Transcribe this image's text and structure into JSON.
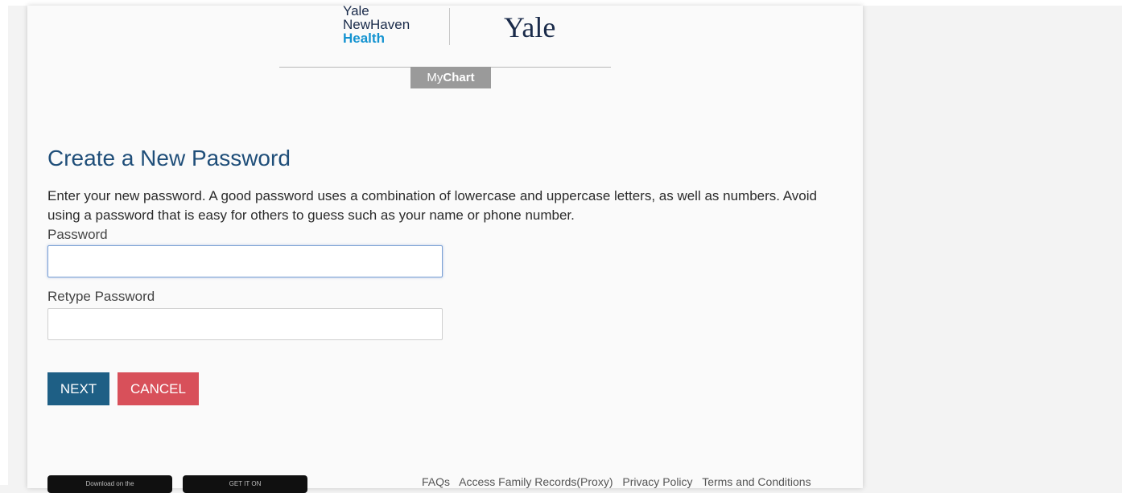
{
  "header": {
    "logo_ynh_line1": "Yale",
    "logo_ynh_line2": "NewHaven",
    "logo_ynh_line3": "Health",
    "logo_yale": "Yale",
    "mychart_my": "My",
    "mychart_chart": "Chart"
  },
  "form": {
    "title": "Create a New Password",
    "instructions": "Enter your new password. A good password uses a combination of lowercase and uppercase letters, as well as numbers. Avoid using a password that is easy for others to guess such as your name or phone number.",
    "password_label": "Password",
    "password_value": "",
    "retype_label": "Retype Password",
    "retype_value": "",
    "next_label": "NEXT",
    "cancel_label": "CANCEL"
  },
  "footer": {
    "app_store_text": "Download on the",
    "google_play_text": "GET IT ON",
    "links": [
      "FAQs",
      "Access Family Records(Proxy)",
      "Privacy Policy",
      "Terms and Conditions"
    ]
  },
  "colors": {
    "title": "#1f4e79",
    "next_button": "#1e5f85",
    "cancel_button": "#d8505a",
    "health_text": "#1493d0"
  }
}
